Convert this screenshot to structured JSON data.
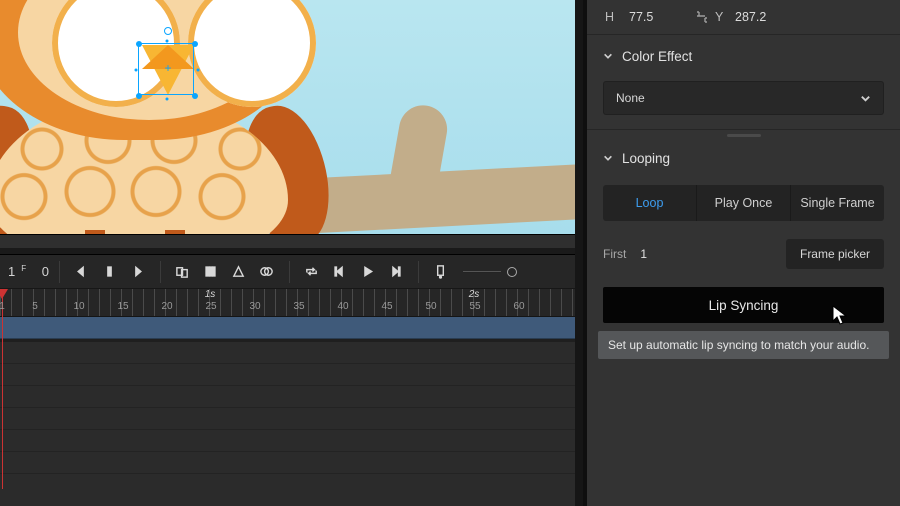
{
  "canvas": {
    "anchor_glyph": "+"
  },
  "timeline": {
    "frame_unit": "F",
    "frame_major": "1",
    "frame_minor": "0",
    "seconds_marker": "1s",
    "seconds_marker2": "2s",
    "ruler_labels": [
      "1",
      "5",
      "10",
      "15",
      "20",
      "25",
      "30",
      "35",
      "40",
      "45",
      "50",
      "55",
      "60"
    ]
  },
  "properties": {
    "h_label": "H",
    "h_value": "77.5",
    "y_label": "Y",
    "y_value": "287.2"
  },
  "color_effect": {
    "title": "Color Effect",
    "value": "None"
  },
  "looping": {
    "title": "Looping",
    "options": {
      "loop": "Loop",
      "play_once": "Play Once",
      "single_frame": "Single Frame"
    },
    "first_label": "First",
    "first_value": "1",
    "frame_picker": "Frame picker",
    "lip_syncing": "Lip Syncing",
    "tooltip": "Set up automatic lip syncing to match your audio."
  }
}
